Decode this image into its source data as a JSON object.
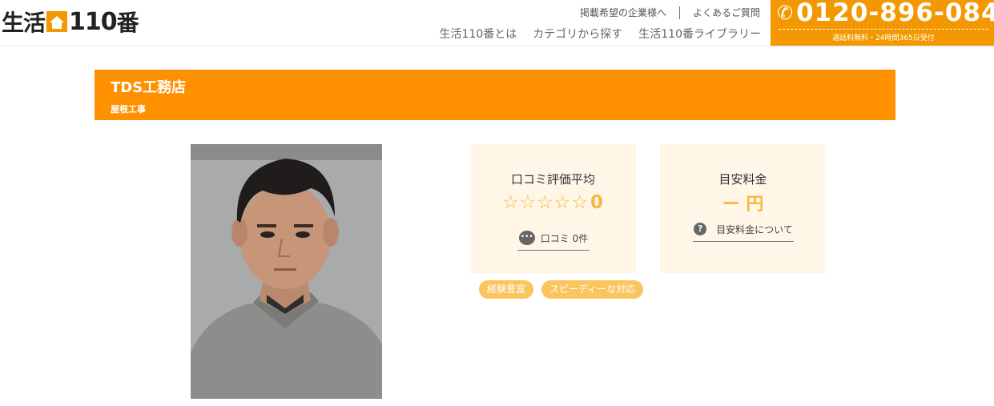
{
  "header": {
    "logo_left": "生活",
    "logo_num": "110",
    "logo_right": "番",
    "top_links": [
      "掲載希望の企業様へ",
      "よくあるご質問"
    ],
    "nav": [
      "生活110番とは",
      "カテゴリから探す",
      "生活110番ライブラリー"
    ],
    "phone": "0120-896-084",
    "phone_note": "通話料無料・24時間365日受付"
  },
  "company": {
    "name": "TDS工務店",
    "category": "屋根工事"
  },
  "rating": {
    "title": "口コミ評価平均",
    "stars": "☆☆☆☆☆",
    "score": "0",
    "stars_filled": 0,
    "reviews_label": "口コミ 0件"
  },
  "price": {
    "title": "目安料金",
    "value": "ー 円",
    "about_label": "目安料金について"
  },
  "tags": [
    "経験豊富",
    "スピーディーな対応"
  ],
  "colors": {
    "accent": "#ff9100",
    "phone_bg": "#f39800",
    "card_bg": "#fff6e8",
    "star": "#f6b93b",
    "tag_bg": "#f9c55c"
  },
  "icons": {
    "phone": "phone-icon",
    "chat": "chat-icon",
    "help": "question-icon",
    "house": "house-icon"
  }
}
